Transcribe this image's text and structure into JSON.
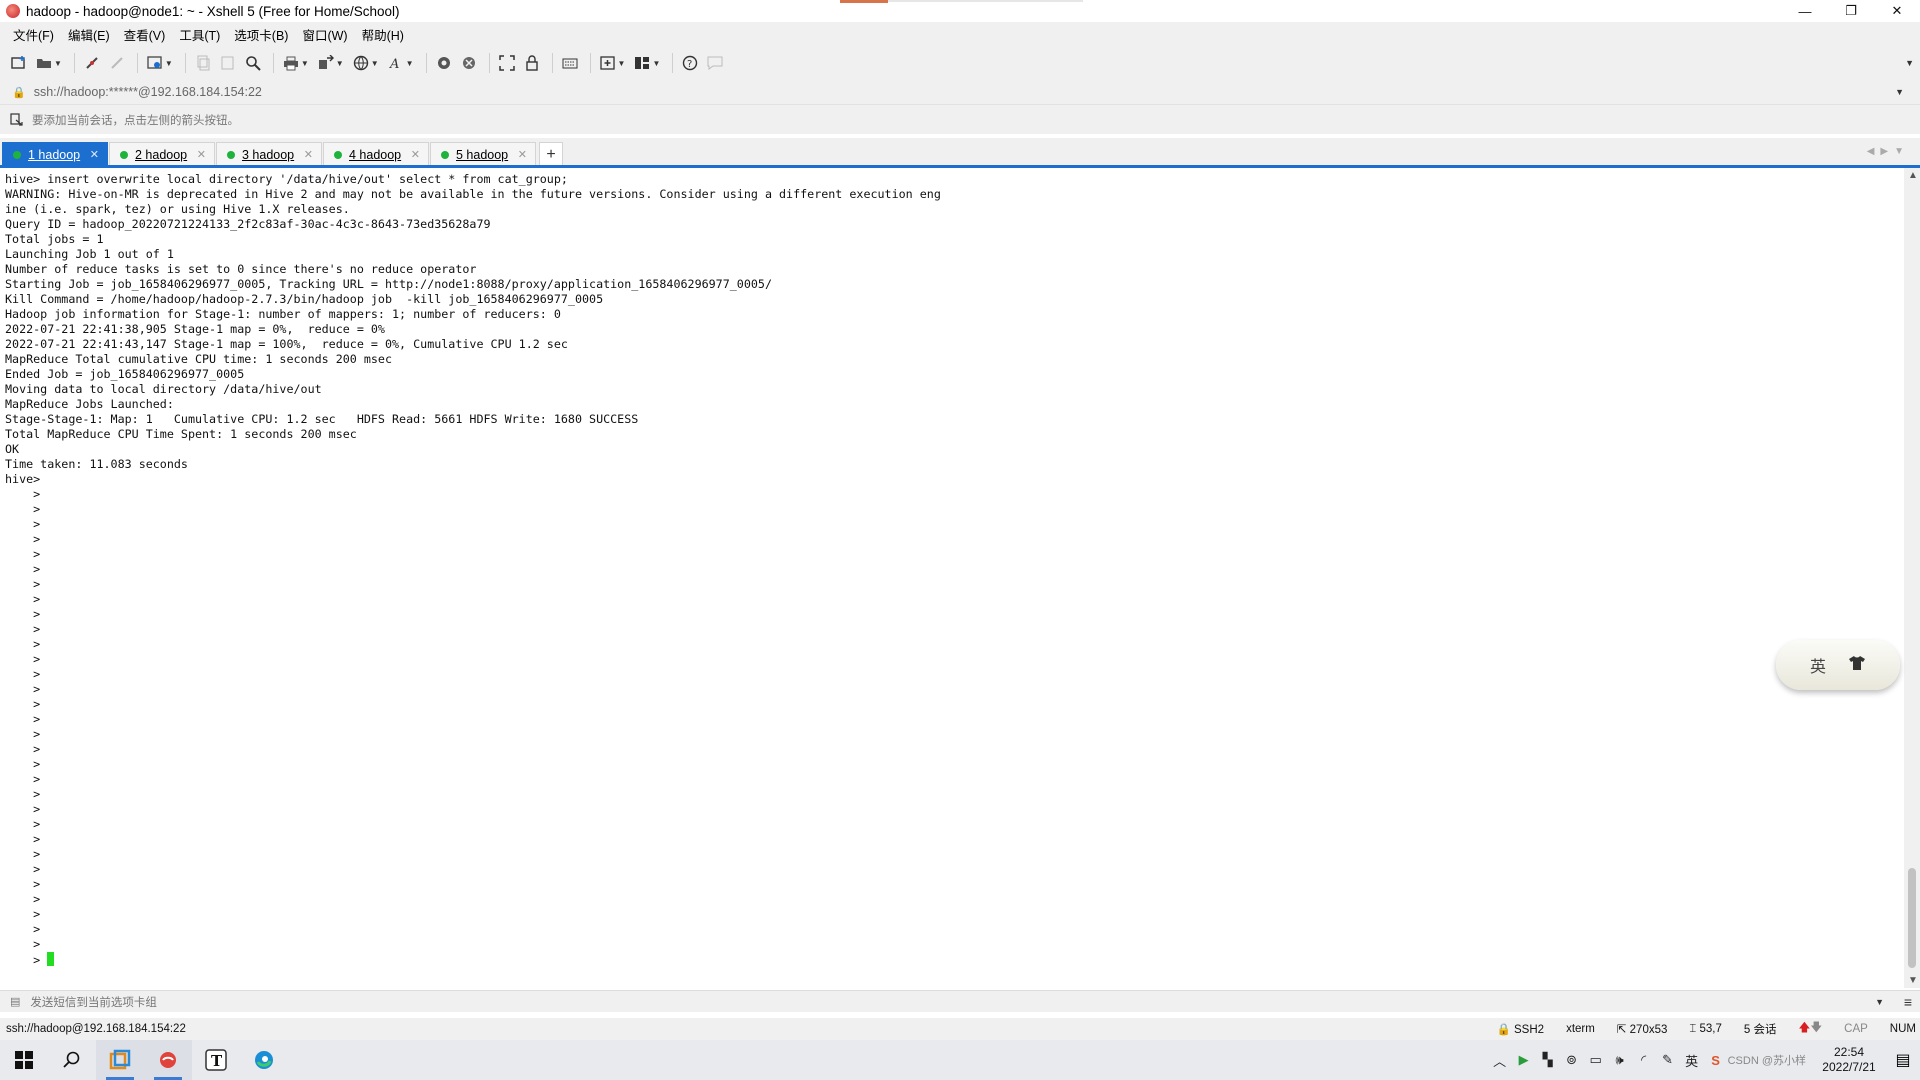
{
  "window": {
    "title": "hadoop - hadoop@node1: ~ - Xshell 5 (Free for Home/School)",
    "minimize": "—",
    "maximize": "❐",
    "close": "✕"
  },
  "menu": [
    "文件(F)",
    "编辑(E)",
    "查看(V)",
    "工具(T)",
    "选项卡(B)",
    "窗口(W)",
    "帮助(H)"
  ],
  "address": {
    "value": "ssh://hadoop:******@192.168.184.154:22"
  },
  "hint": {
    "text": "要添加当前会话，点击左侧的箭头按钮。"
  },
  "tabs": [
    {
      "label": "1 hadoop",
      "active": true
    },
    {
      "label": "2 hadoop",
      "active": false
    },
    {
      "label": "3 hadoop",
      "active": false
    },
    {
      "label": "4 hadoop",
      "active": false
    },
    {
      "label": "5 hadoop",
      "active": false
    }
  ],
  "terminal": {
    "lines": [
      "hive> insert overwrite local directory '/data/hive/out' select * from cat_group;",
      "WARNING: Hive-on-MR is deprecated in Hive 2 and may not be available in the future versions. Consider using a different execution eng",
      "ine (i.e. spark, tez) or using Hive 1.X releases.",
      "Query ID = hadoop_20220721224133_2f2c83af-30ac-4c3c-8643-73ed35628a79",
      "Total jobs = 1",
      "Launching Job 1 out of 1",
      "Number of reduce tasks is set to 0 since there's no reduce operator",
      "Starting Job = job_1658406296977_0005, Tracking URL = http://node1:8088/proxy/application_1658406296977_0005/",
      "Kill Command = /home/hadoop/hadoop-2.7.3/bin/hadoop job  -kill job_1658406296977_0005",
      "Hadoop job information for Stage-1: number of mappers: 1; number of reducers: 0",
      "2022-07-21 22:41:38,905 Stage-1 map = 0%,  reduce = 0%",
      "2022-07-21 22:41:43,147 Stage-1 map = 100%,  reduce = 0%, Cumulative CPU 1.2 sec",
      "MapReduce Total cumulative CPU time: 1 seconds 200 msec",
      "Ended Job = job_1658406296977_0005",
      "Moving data to local directory /data/hive/out",
      "MapReduce Jobs Launched:",
      "Stage-Stage-1: Map: 1   Cumulative CPU: 1.2 sec   HDFS Read: 5661 HDFS Write: 1680 SUCCESS",
      "Total MapReduce CPU Time Spent: 1 seconds 200 msec",
      "OK",
      "Time taken: 11.083 seconds",
      "hive>",
      "    >",
      "    >",
      "    >",
      "    >",
      "    >",
      "    >",
      "    >",
      "    >",
      "    >",
      "    >",
      "    >",
      "    >",
      "    >",
      "    >",
      "    >",
      "    >",
      "    >",
      "    >",
      "    >",
      "    >",
      "    >",
      "    >",
      "    >",
      "    >",
      "    >",
      "    >",
      "    >",
      "    >",
      "    >",
      "    >",
      "    >"
    ],
    "prompt_last": "    > "
  },
  "ime": {
    "mode": "英",
    "skin_icon": "shirt-icon"
  },
  "compose": {
    "placeholder": "发送短信到当前选项卡组"
  },
  "status": {
    "connection": "ssh://hadoop@192.168.184.154:22",
    "protocol": "SSH2",
    "terminal_type": "xterm",
    "size": "270x53",
    "cursor_pos": "53,7",
    "sessions": "5 会话",
    "caps": "CAP",
    "num": "NUM"
  },
  "taskbar": {
    "clock_time": "22:54",
    "clock_date": "2022/7/21",
    "watermark": "CSDN @苏小样",
    "ime_tray": "英"
  },
  "colors": {
    "accent": "#1c6fcf",
    "cursor": "#22dd22",
    "tab_dot": "#1fb33d"
  }
}
